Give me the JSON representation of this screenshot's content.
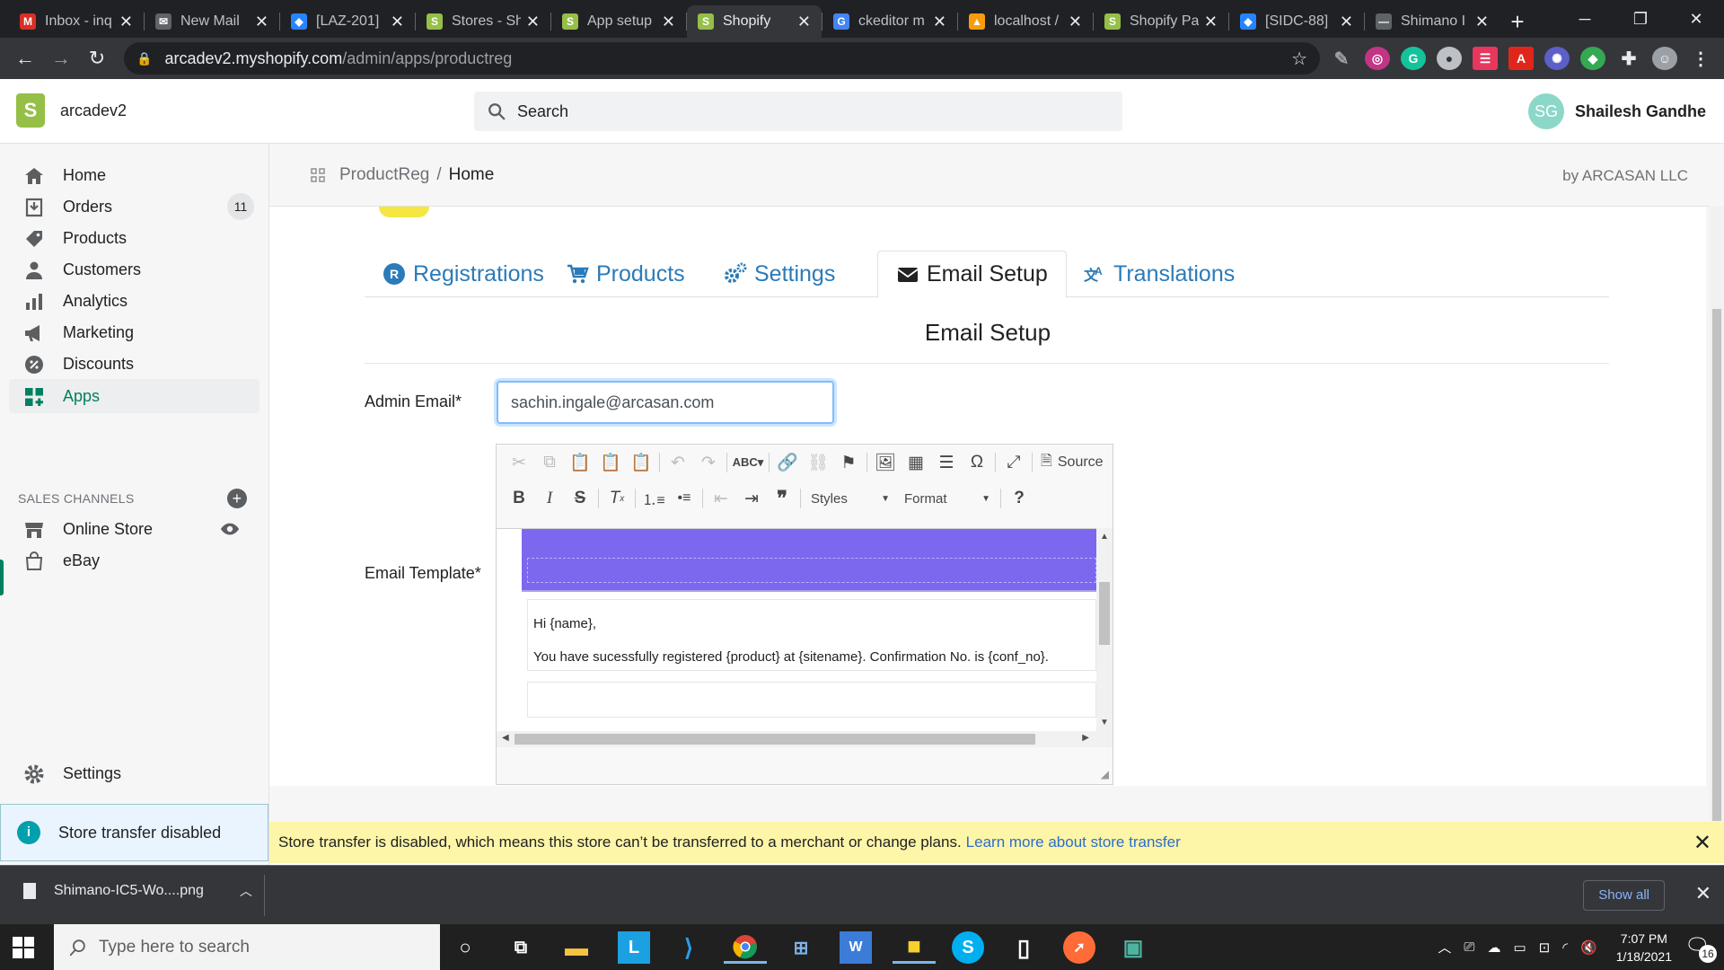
{
  "browser": {
    "tabs": [
      {
        "title": "Inbox - inq",
        "icon": "gmail-icon",
        "color": "#d93025",
        "glyph": "M"
      },
      {
        "title": "New Mail",
        "icon": "mail-icon",
        "color": "#5f6368",
        "glyph": "✉"
      },
      {
        "title": "[LAZ-201]",
        "icon": "jira-icon",
        "color": "#2684ff",
        "glyph": "◆"
      },
      {
        "title": "Stores - Sh",
        "icon": "shopify-icon",
        "color": "#95bf47",
        "glyph": "S"
      },
      {
        "title": "App setup",
        "icon": "shopify-icon",
        "color": "#95bf47",
        "glyph": "S"
      },
      {
        "title": "Shopify",
        "icon": "shopify-icon",
        "color": "#95bf47",
        "glyph": "S"
      },
      {
        "title": "ckeditor m",
        "icon": "google-icon",
        "color": "#4285f4",
        "glyph": "G"
      },
      {
        "title": "localhost /",
        "icon": "phpmyadmin-icon",
        "color": "#f89c0e",
        "glyph": "▲"
      },
      {
        "title": "Shopify Pa",
        "icon": "shopify-icon",
        "color": "#95bf47",
        "glyph": "S"
      },
      {
        "title": "[SIDC-88]",
        "icon": "jira-icon",
        "color": "#2684ff",
        "glyph": "◆"
      },
      {
        "title": "Shimano I",
        "icon": "shimano-icon",
        "color": "#5f6368",
        "glyph": "—"
      }
    ],
    "active_tab": 5,
    "url_host": "arcadev2.myshopify.com",
    "url_path": "/admin/apps/productreg"
  },
  "shopify": {
    "store_name": "arcadev2",
    "search_placeholder": "Search",
    "user_initials": "SG",
    "user_name": "Shailesh Gandhe"
  },
  "sidebar": {
    "items": [
      {
        "label": "Home",
        "icon": "home-icon"
      },
      {
        "label": "Orders",
        "icon": "orders-icon",
        "badge": "11"
      },
      {
        "label": "Products",
        "icon": "tag-icon"
      },
      {
        "label": "Customers",
        "icon": "person-icon"
      },
      {
        "label": "Analytics",
        "icon": "bar-chart-icon"
      },
      {
        "label": "Marketing",
        "icon": "megaphone-icon"
      },
      {
        "label": "Discounts",
        "icon": "discount-icon"
      },
      {
        "label": "Apps",
        "icon": "apps-icon"
      }
    ],
    "sales_channels_heading": "SALES CHANNELS",
    "channels": [
      {
        "label": "Online Store",
        "icon": "store-icon"
      },
      {
        "label": "eBay",
        "icon": "bag-icon"
      }
    ],
    "settings_label": "Settings",
    "transfer_notice": "Store transfer disabled"
  },
  "app": {
    "breadcrumb_app": "ProductReg",
    "breadcrumb_sep": "/",
    "breadcrumb_page": "Home",
    "byline": "by ARCASAN LLC",
    "tabs": [
      {
        "label": "Registrations",
        "icon": "registered-icon"
      },
      {
        "label": "Products",
        "icon": "cart-icon"
      },
      {
        "label": "Settings",
        "icon": "cogs-icon"
      },
      {
        "label": "Email Setup",
        "icon": "envelope-icon"
      },
      {
        "label": "Translations",
        "icon": "language-icon"
      }
    ],
    "active_tab": "Email Setup",
    "section_title": "Email Setup",
    "admin_email_label": "Admin Email*",
    "admin_email_value": "sachin.ingale@arcasan.com",
    "email_template_label": "Email Template*",
    "editor": {
      "source_label": "Source",
      "styles_label": "Styles",
      "format_label": "Format",
      "help_label": "?",
      "body_line1": "Hi {name},",
      "body_line2": "You have sucessfully registered {product} at {sitename}. Confirmation No. is {conf_no}."
    }
  },
  "banner": {
    "text": "Store transfer is disabled, which means this store can’t be transferred to a merchant or change plans.",
    "link": "Learn more about store transfer"
  },
  "download": {
    "filename": "Shimano-IC5-Wo....png",
    "show_all": "Show all"
  },
  "taskbar": {
    "search_placeholder": "Type here to search",
    "time": "7:07 PM",
    "date": "1/18/2021",
    "notifications": "16"
  }
}
